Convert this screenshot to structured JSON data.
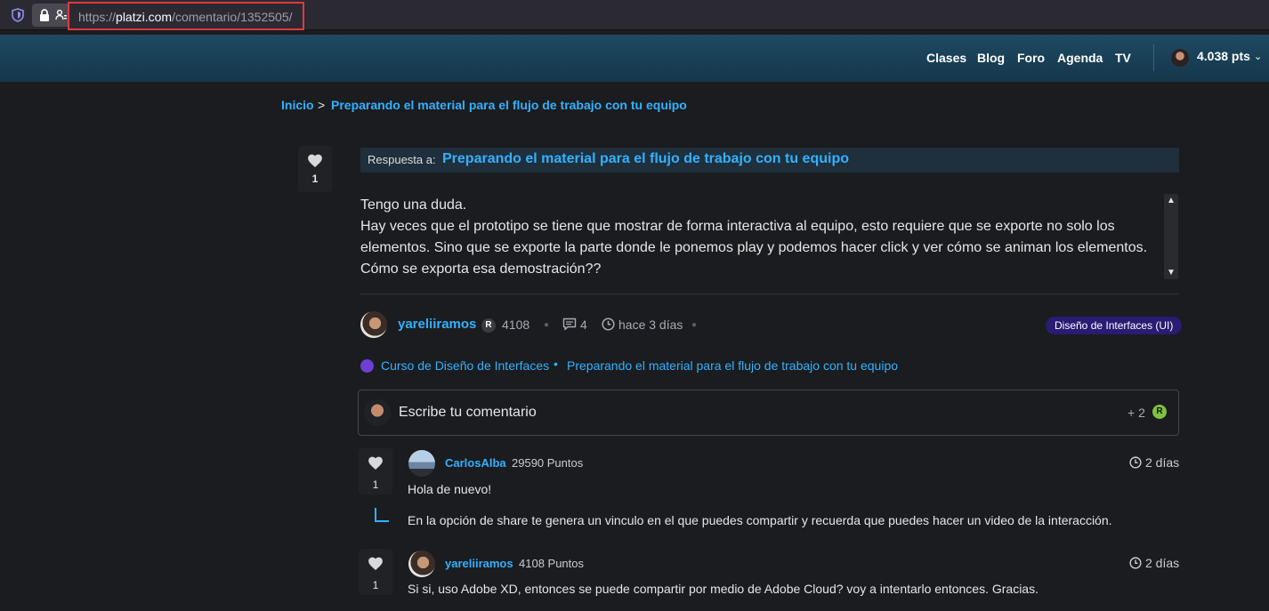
{
  "browser": {
    "url_prefix": "https://",
    "url_host": "platzi.com",
    "url_path": "/comentario/1352505/"
  },
  "header": {
    "nav": [
      "Clases",
      "Blog",
      "Foro",
      "Agenda",
      "TV"
    ],
    "points": "4.038 pts"
  },
  "breadcrumb": {
    "home": "Inicio",
    "separator": ">",
    "current": "Preparando el material para el flujo de trabajo con tu equipo"
  },
  "question": {
    "likes": "1",
    "reply_label": "Respuesta a:",
    "reply_title": "Preparando el material para el flujo de trabajo con tu equipo",
    "body": [
      "Tengo una duda.",
      "Hay veces que el prototipo se tiene que mostrar de forma interactiva al equipo, esto requiere que se exporte no solo los elementos. Sino que se exporte la parte donde le ponemos play y podemos hacer click y ver cómo se animan los elementos.",
      "Cómo se exporta esa demostración??"
    ],
    "author": "yareliiramos",
    "author_badge": "R",
    "author_points": "4108",
    "comments_count": "4",
    "time": "hace 3 días",
    "tag": "Diseño de Interfaces (UI)",
    "course": "Curso de Diseño de Interfaces",
    "course_separator": "•",
    "class": "Preparando el material para el flujo de trabajo con tu equipo"
  },
  "comment_box": {
    "placeholder": "Escribe tu comentario",
    "reward": "+ 2",
    "reward_badge": "R"
  },
  "replies": [
    {
      "likes": "1",
      "author": "CarlosAlba",
      "points": "29590 Puntos",
      "time": "2 días",
      "lines": [
        "Hola de nuevo!",
        "En la opción de share te genera un vinculo en el que puedes compartir y recuerda que puedes hacer un video de la interacción."
      ]
    },
    {
      "likes": "1",
      "author": "yareliiramos",
      "points": "4108 Puntos",
      "time": "2 días",
      "lines": [
        "Si si, uso Adobe XD, entonces se puede compartir por medio de Adobe Cloud? voy a intentarlo entonces. Gracias."
      ]
    }
  ],
  "colors": {
    "link": "#33b1ff",
    "tag_bg": "#2a1b73",
    "badge_green": "#7ec243",
    "url_outline": "#e0393e"
  }
}
